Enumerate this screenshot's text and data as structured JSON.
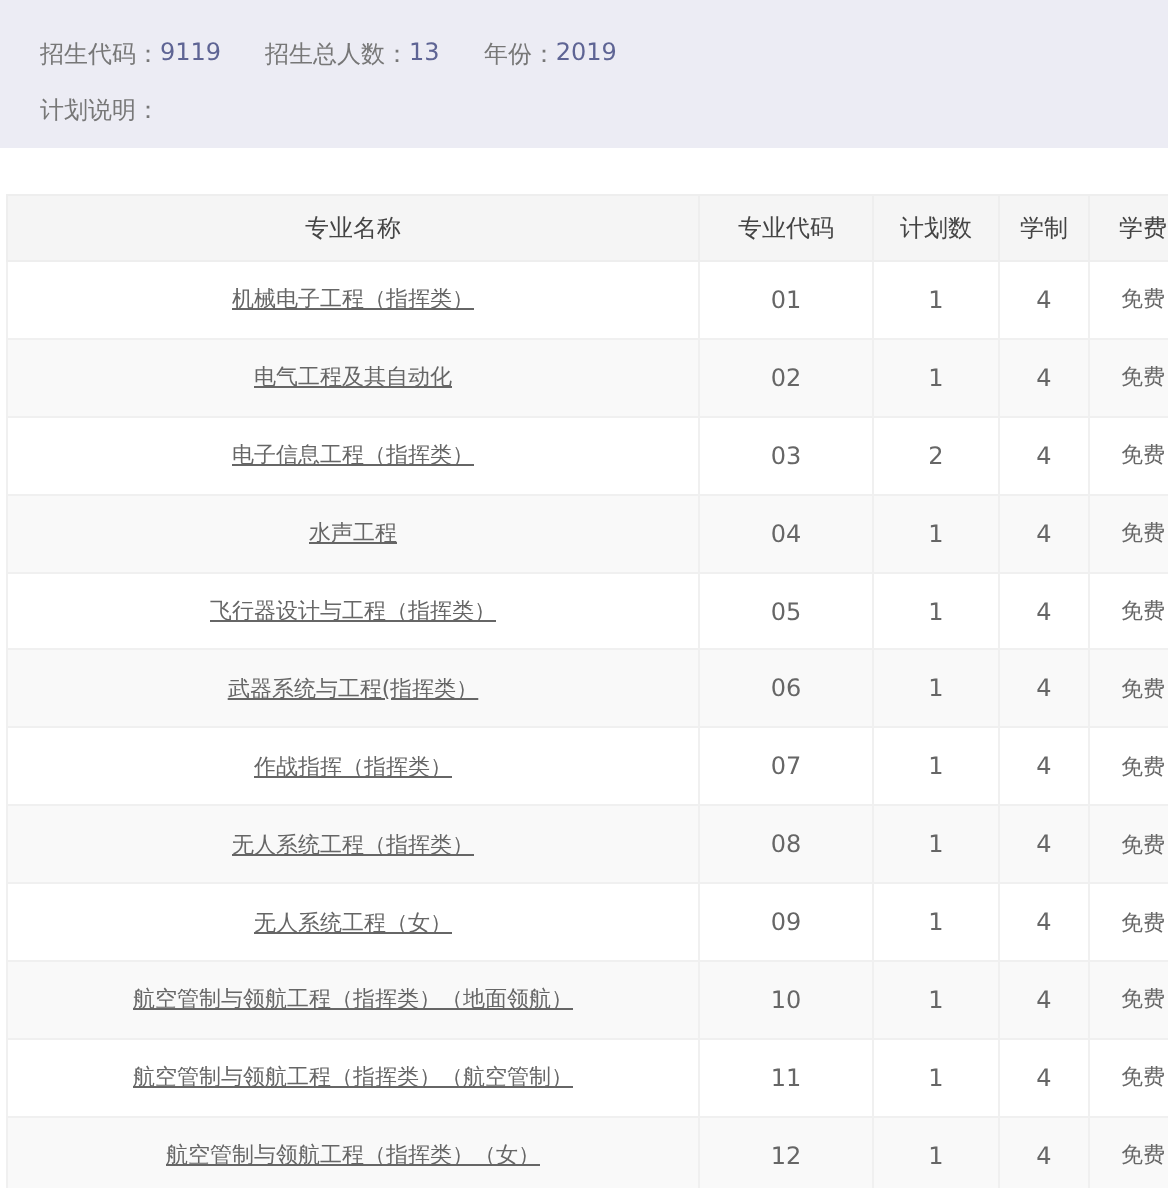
{
  "info": {
    "fields": [
      {
        "label": "招生代码：",
        "value": "9119"
      },
      {
        "label": "招生总人数：",
        "value": "13"
      },
      {
        "label": "年份：",
        "value": "2019"
      }
    ],
    "note_label": "计划说明："
  },
  "table": {
    "columns": [
      "专业名称",
      "专业代码",
      "计划数",
      "学制",
      "学费"
    ],
    "rows": [
      [
        "机械电子工程（指挥类）",
        "01",
        "1",
        "4",
        "免费"
      ],
      [
        "电气工程及其自动化",
        "02",
        "1",
        "4",
        "免费"
      ],
      [
        "电子信息工程（指挥类）",
        "03",
        "2",
        "4",
        "免费"
      ],
      [
        "水声工程",
        "04",
        "1",
        "4",
        "免费"
      ],
      [
        "飞行器设计与工程（指挥类）",
        "05",
        "1",
        "4",
        "免费"
      ],
      [
        "武器系统与工程(指挥类）",
        "06",
        "1",
        "4",
        "免费"
      ],
      [
        "作战指挥（指挥类）",
        "07",
        "1",
        "4",
        "免费"
      ],
      [
        "无人系统工程（指挥类）",
        "08",
        "1",
        "4",
        "免费"
      ],
      [
        "无人系统工程（女）",
        "09",
        "1",
        "4",
        "免费"
      ],
      [
        "航空管制与领航工程（指挥类）（地面领航）",
        "10",
        "1",
        "4",
        "免费"
      ],
      [
        "航空管制与领航工程（指挥类）（航空管制）",
        "11",
        "1",
        "4",
        "免费"
      ],
      [
        "航空管制与领航工程（指挥类）（女）",
        "12",
        "1",
        "4",
        "免费"
      ]
    ]
  }
}
